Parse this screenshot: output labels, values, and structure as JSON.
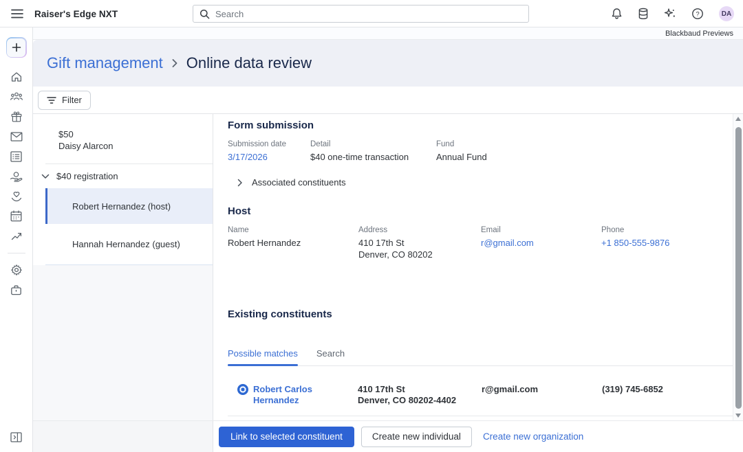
{
  "colors": {
    "link_blue": "#3b6fd4",
    "primary_button_blue": "#2e63d4",
    "heading_navy": "#19284a",
    "banner_bg": "#eef0f6",
    "selected_row_bg": "#e9eef9",
    "avatar_bg": "#e7d9f6"
  },
  "topbar": {
    "app_title": "Raiser's Edge NXT",
    "search": {
      "placeholder": "Search"
    },
    "icons": [
      "notifications-bell-icon",
      "database-icon",
      "ai-sparkle-icon",
      "help-icon"
    ],
    "avatar": {
      "initials": "DA"
    }
  },
  "previews_bar": {
    "label": "Blackbaud Previews"
  },
  "nav_sidebar": {
    "add_button": "+",
    "icons": [
      "home-icon",
      "constituents-icon",
      "gifts-icon",
      "email-icon",
      "lists-icon",
      "fundraising-icon",
      "events-icon",
      "calendar-icon",
      "analysis-icon"
    ],
    "footer_icons": [
      "settings-gear-icon",
      "tools-icon"
    ],
    "collapse_icon": "collapse-panel-icon"
  },
  "breadcrumb": {
    "parent": "Gift management",
    "current": "Online data review"
  },
  "toolbar": {
    "filter_label": "Filter"
  },
  "transactions_panel": {
    "items": [
      {
        "line1": "$50",
        "line2": "Daisy Alarcon"
      },
      {
        "group_label": "$40 registration",
        "children": [
          {
            "label": "Robert Hernandez (host)",
            "selected": true
          },
          {
            "label": "Hannah Hernandez (guest)",
            "selected": false
          }
        ]
      }
    ]
  },
  "form_submission": {
    "title": "Form submission",
    "fields": [
      {
        "label": "Submission date",
        "value": "3/17/2026"
      },
      {
        "label": "Detail",
        "value": "$40 one-time transaction"
      },
      {
        "label": "Fund",
        "value": "Annual Fund"
      }
    ],
    "associated_constituents_label": "Associated constituents"
  },
  "host_section": {
    "title": "Host",
    "fields": [
      {
        "label": "Name",
        "value": "Robert Hernandez"
      },
      {
        "label": "Address",
        "value": "410 17th St",
        "value2": "Denver, CO 80202"
      },
      {
        "label": "Email",
        "value": "r@gmail.com"
      },
      {
        "label": "Phone",
        "value": "+1 850-555-9876"
      }
    ]
  },
  "existing_constituents": {
    "title": "Existing constituents",
    "tabs": [
      {
        "label": "Possible matches",
        "active": true
      },
      {
        "label": "Search",
        "active": false
      }
    ],
    "matches": [
      {
        "name": "Robert Carlos Hernandez",
        "address_line1": "410 17th St",
        "address_line2": "Denver, CO 80202-4402",
        "email": "r@gmail.com",
        "phone": "(319) 745-6852",
        "selected": true
      }
    ]
  },
  "footer_actions": {
    "primary": "Link to selected constituent",
    "secondary": "Create new individual",
    "link": "Create new organization"
  }
}
